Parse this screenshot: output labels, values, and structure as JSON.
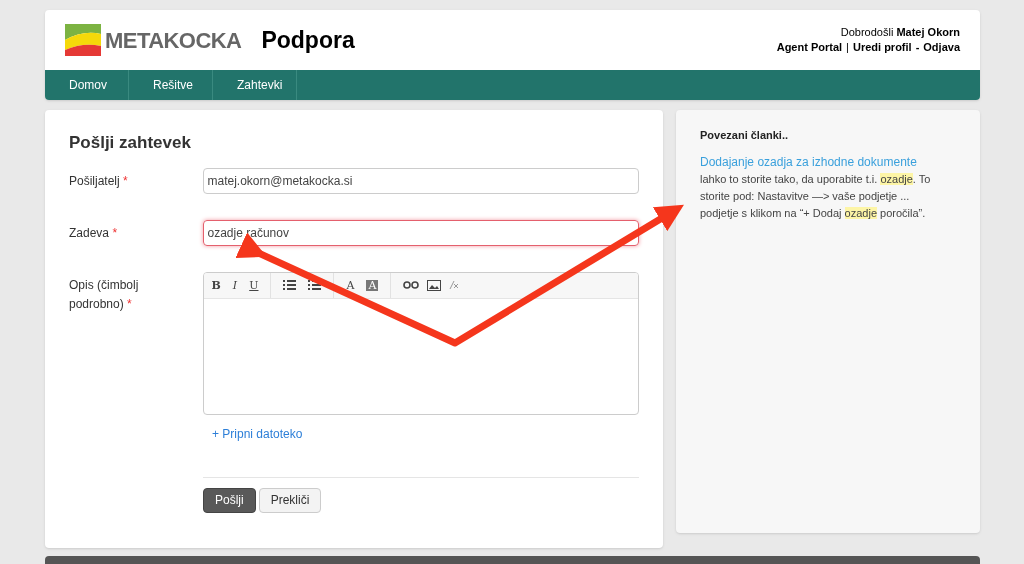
{
  "header": {
    "brand": "METAKOCKA",
    "title": "Podpora",
    "greeting": "Dobrodošli",
    "user": "Matej Okorn",
    "links": [
      "Agent Portal",
      "Uredi profil",
      "Odjava"
    ],
    "separators": [
      "|",
      "-"
    ]
  },
  "nav": [
    {
      "label": "Domov"
    },
    {
      "label": "Rešitve"
    },
    {
      "label": "Zahtevki"
    }
  ],
  "form": {
    "title": "Pošlji zahtevek",
    "fields": [
      {
        "label": "Pošiljatelj",
        "required_mark": "*",
        "kind": "text",
        "value": "matej.okorn@metakocka.si",
        "invalid": false
      },
      {
        "label": "Zadeva",
        "required_mark": "*",
        "kind": "text",
        "value": "ozadje računov",
        "invalid": true
      },
      {
        "label": "Opis (čimbolj podrobno)",
        "required_mark": "*",
        "kind": "editor",
        "toolbar": [
          "B",
          "I",
          "U",
          "A",
          "A"
        ]
      }
    ],
    "attach": "+ Pripni datoteko",
    "buttons": [
      {
        "label": "Pošlji",
        "kind": "primary"
      },
      {
        "label": "Prekliči",
        "kind": "secondary"
      }
    ]
  },
  "related": {
    "title": "Povezani članki..",
    "articles": [
      {
        "link": "Dodajanje ozadja za izhodne dokumente",
        "lines": [
          "lahko to storite tako, da uporabite t.i. **ozadje**. To",
          "storite pod: Nastavitve —> vaše podjetje ...",
          "podjetje s klikom na “+ Dodaj **ozadje** poročila”."
        ]
      }
    ]
  }
}
